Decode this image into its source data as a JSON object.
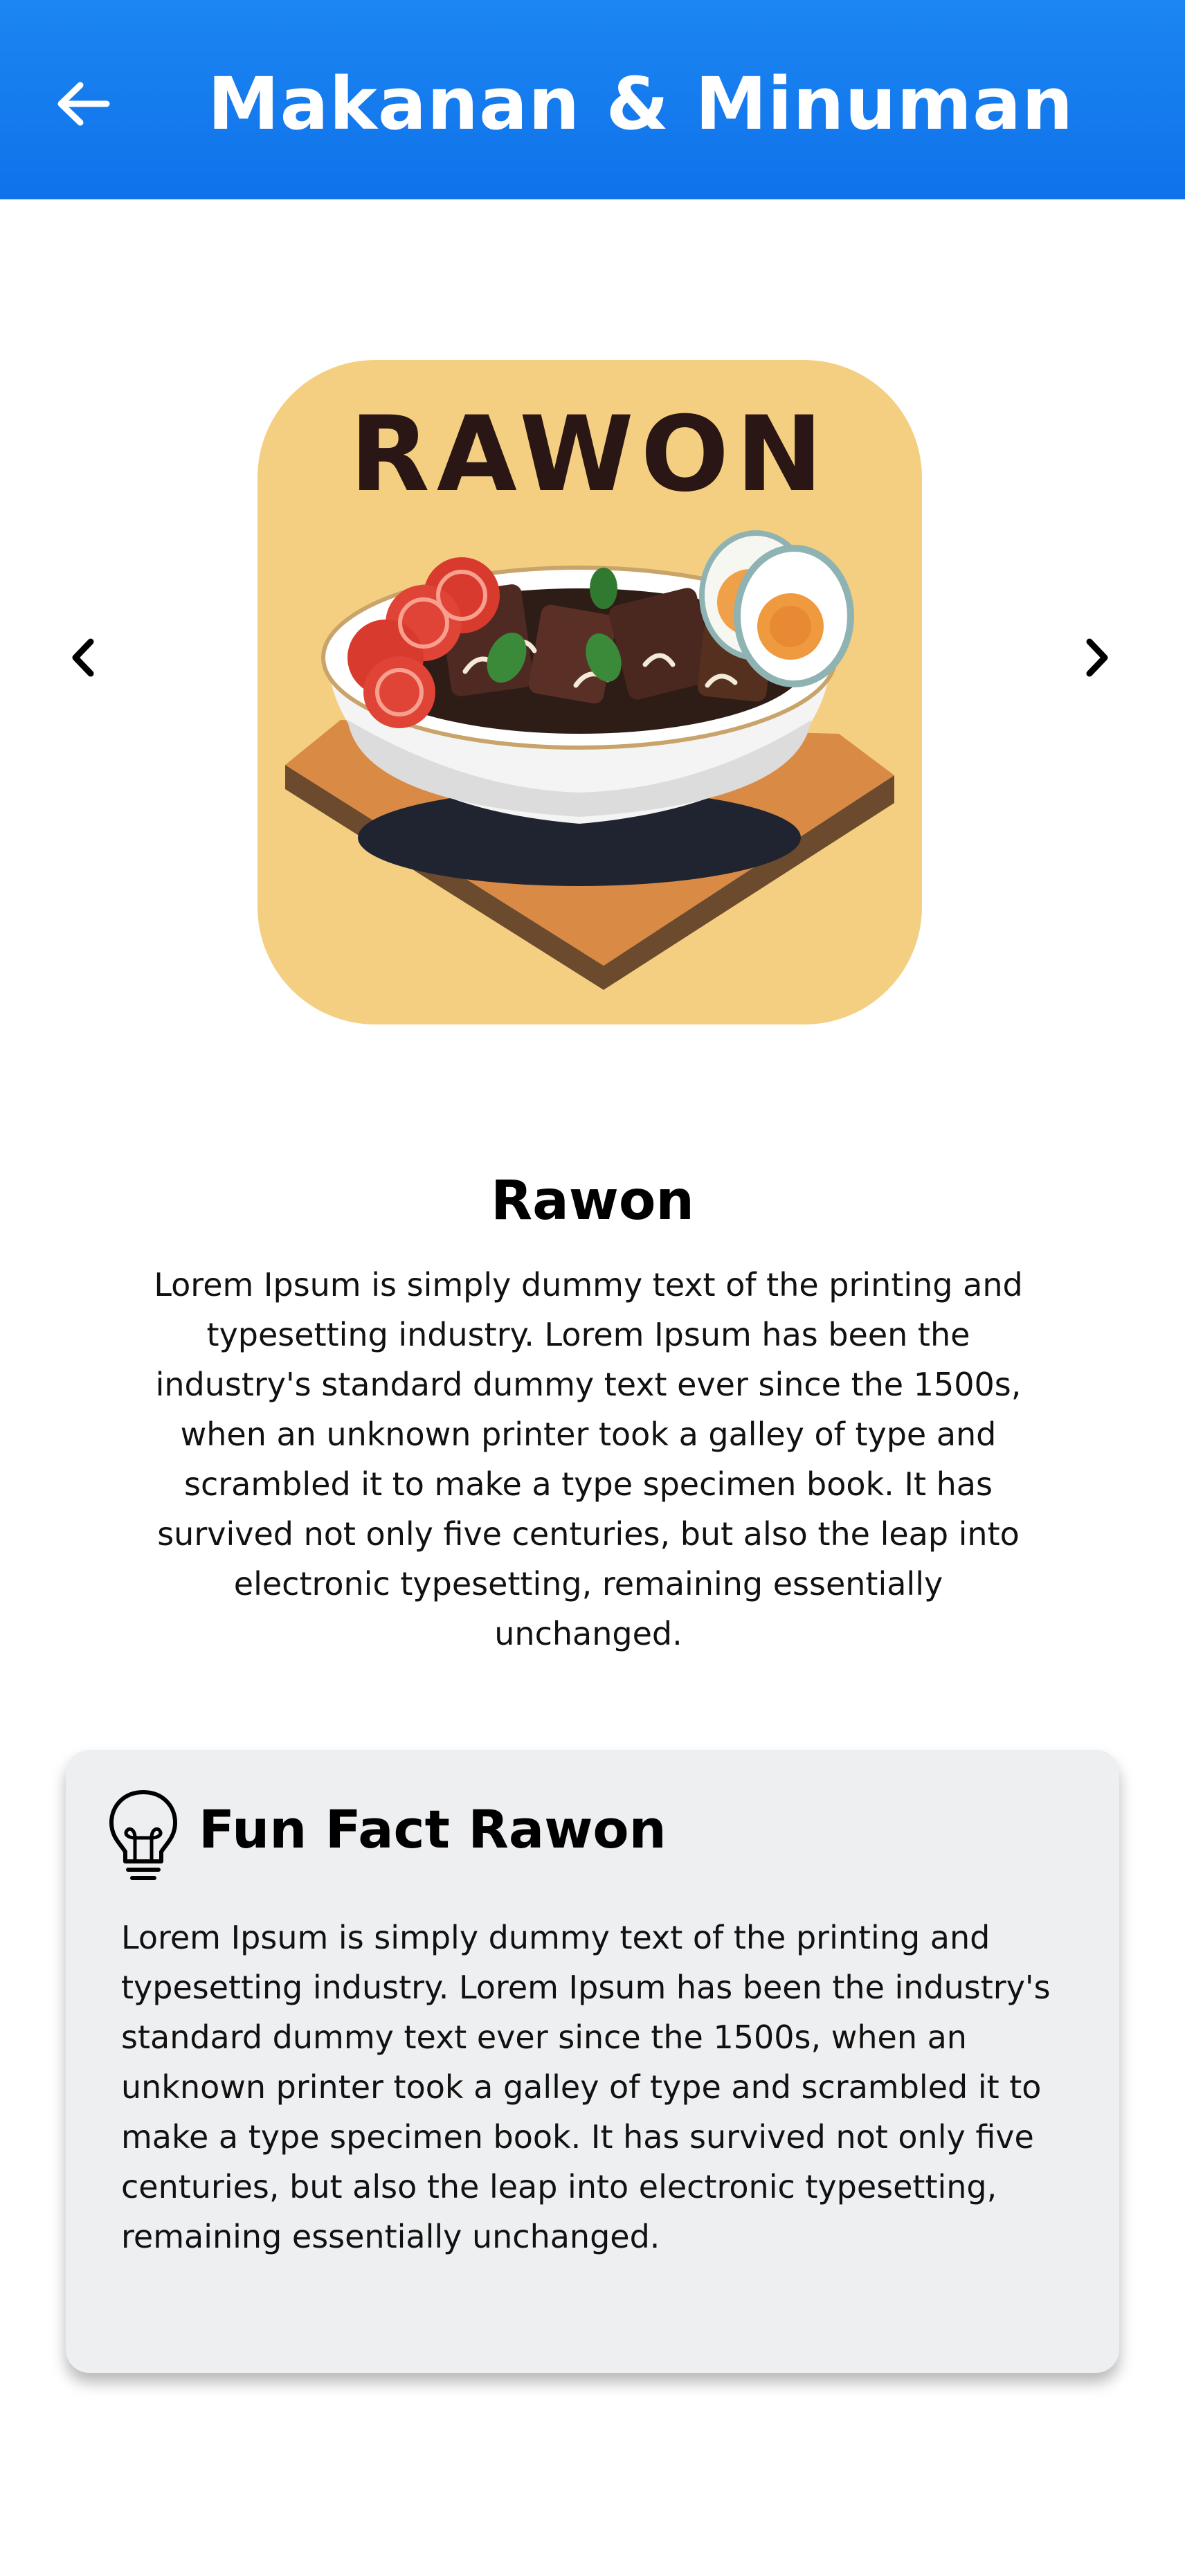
{
  "header": {
    "title": "Makanan & Minuman",
    "back_icon": "arrow-left-icon"
  },
  "carousel": {
    "prev_icon": "chevron-left-icon",
    "next_icon": "chevron-right-icon",
    "image_label": "RAWON"
  },
  "food": {
    "name": "Rawon",
    "description": "Lorem Ipsum is simply dummy text of the printing and typesetting industry. Lorem Ipsum has been the industry's standard dummy text ever since the 1500s, when an unknown printer took a galley of type and scrambled it to make a type specimen book. It has survived not only five centuries, but also the leap into electronic typesetting, remaining essentially unchanged."
  },
  "fun_fact": {
    "icon": "lightbulb-icon",
    "title": "Fun Fact Rawon",
    "text": "Lorem Ipsum is simply dummy text of the printing and typesetting industry. Lorem Ipsum has been the industry's standard dummy text ever since the 1500s, when an unknown printer took a galley of type and scrambled it to make a type specimen book. It has survived not only five centuries, but also the leap into electronic typesetting, remaining essentially unchanged."
  },
  "colors": {
    "appbar": "#1479ee",
    "image_background": "#f4cf82",
    "card_background": "#eeeff1"
  }
}
